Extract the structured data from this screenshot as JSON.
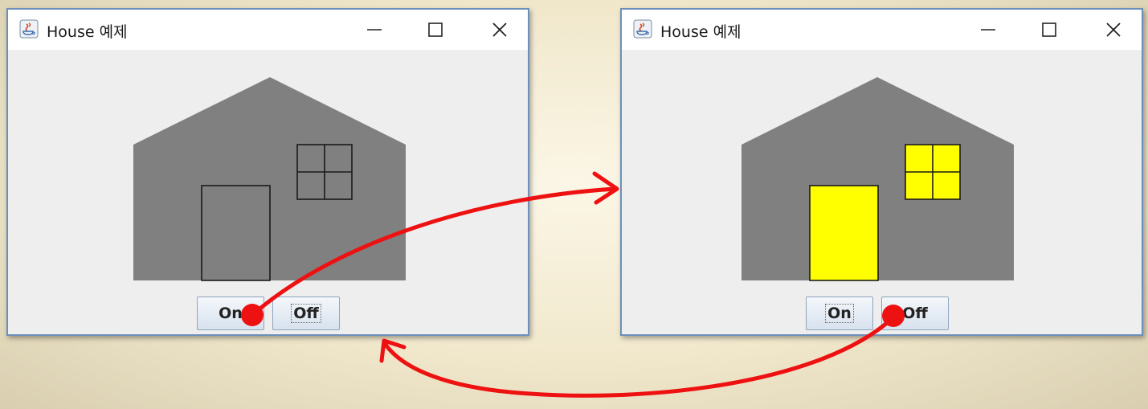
{
  "windows": [
    {
      "title": "House 예제",
      "state": "lights-off",
      "colors": {
        "house": "#808080",
        "door": "#808080",
        "window": "#808080",
        "outline": "#1a1a1a"
      },
      "buttons": {
        "on_label": "On",
        "off_label": "Off",
        "focused": "off"
      }
    },
    {
      "title": "House 예제",
      "state": "lights-on",
      "colors": {
        "house": "#808080",
        "door": "#ffff00",
        "window": "#ffff00",
        "outline": "#1a1a1a"
      },
      "buttons": {
        "on_label": "On",
        "off_label": "Off",
        "focused": "on"
      }
    }
  ],
  "window_controls": [
    "minimize-icon",
    "maximize-icon",
    "close-icon"
  ],
  "annotation_color": "#ee1111"
}
